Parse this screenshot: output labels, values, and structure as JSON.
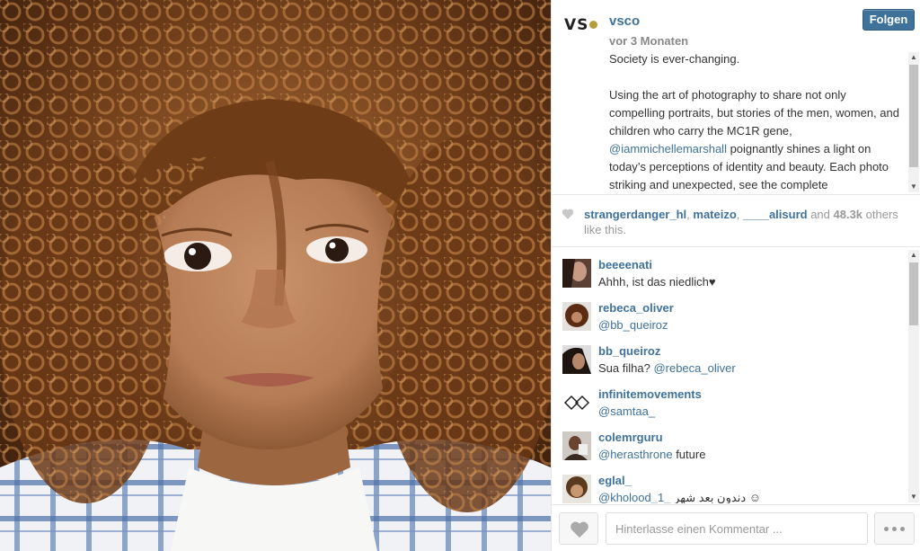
{
  "post": {
    "image_alt": "Portrait of a child with curly hair",
    "owner": "vsco",
    "avatar_text": "VS",
    "time_ago": "vor 3 Monaten",
    "follow_label": "Folgen",
    "caption_parts": {
      "p1": "Society is ever-changing.",
      "p2a": "Using the art of photography to share not only compelling portraits, but stories of the men, women, and children who carry the MC1R gene, ",
      "mention": "@iammichellemarshall",
      "p2b": " poignantly shines a light on today’s perceptions of identity and beauty. Each photo striking and unexpected, see the complete"
    }
  },
  "likes": {
    "users": [
      "strangerdanger_hl",
      "mateizo",
      "____alisurd"
    ],
    "sep1": ", ",
    "sep2": ", ",
    "and": " and ",
    "count": "48.3k",
    "suffix": " others like this."
  },
  "comments": [
    {
      "user": "beeeenati",
      "text": "Ahhh, ist das niedlich♥",
      "mention": "",
      "after": ""
    },
    {
      "user": "rebeca_oliver",
      "text": "",
      "mention": "@bb_queiroz",
      "after": ""
    },
    {
      "user": "bb_queiroz",
      "text": "Sua filha? ",
      "mention": "@rebeca_oliver",
      "after": ""
    },
    {
      "user": "infinitemovements",
      "text": "",
      "mention": "@samtaa_",
      "after": ""
    },
    {
      "user": "colemrguru",
      "text": "",
      "mention": "@herasthrone",
      "after": " future"
    },
    {
      "user": "eglal_",
      "text": "",
      "mention": "@kholood_1_",
      "after": " دندون بعد شهر ☺"
    }
  ],
  "footer": {
    "comment_placeholder": "Hinterlasse einen Kommentar ..."
  },
  "colors": {
    "link": "#3f729b",
    "follow_bg": "#3f729b",
    "text": "#333333",
    "muted": "#999999"
  },
  "icons": [
    "heart-icon",
    "more-dots-icon",
    "scroll-up-arrow",
    "scroll-down-arrow"
  ]
}
